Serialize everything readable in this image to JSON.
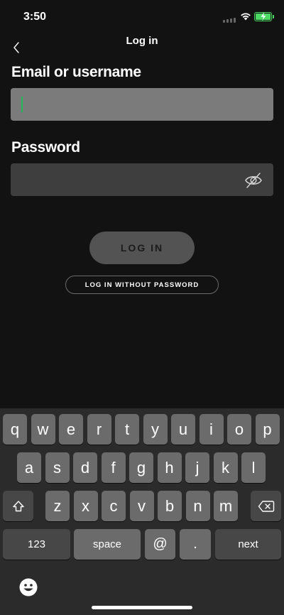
{
  "status_bar": {
    "time": "3:50"
  },
  "header": {
    "title": "Log in"
  },
  "form": {
    "email_label": "Email or username",
    "email_value": "",
    "password_label": "Password",
    "password_value": ""
  },
  "buttons": {
    "login": "LOG IN",
    "login_without_password": "LOG IN WITHOUT PASSWORD"
  },
  "keyboard": {
    "row1": [
      "q",
      "w",
      "e",
      "r",
      "t",
      "y",
      "u",
      "i",
      "o",
      "p"
    ],
    "row2": [
      "a",
      "s",
      "d",
      "f",
      "g",
      "h",
      "j",
      "k",
      "l"
    ],
    "row3": [
      "z",
      "x",
      "c",
      "v",
      "b",
      "n",
      "m"
    ],
    "numbers_key": "123",
    "space_key": "space",
    "at_key": "@",
    "dot_key": ".",
    "next_key": "next"
  },
  "colors": {
    "background": "#121212",
    "accent_green": "#1db954",
    "email_field": "#7b7b7b",
    "password_field": "#3e3e3e"
  }
}
